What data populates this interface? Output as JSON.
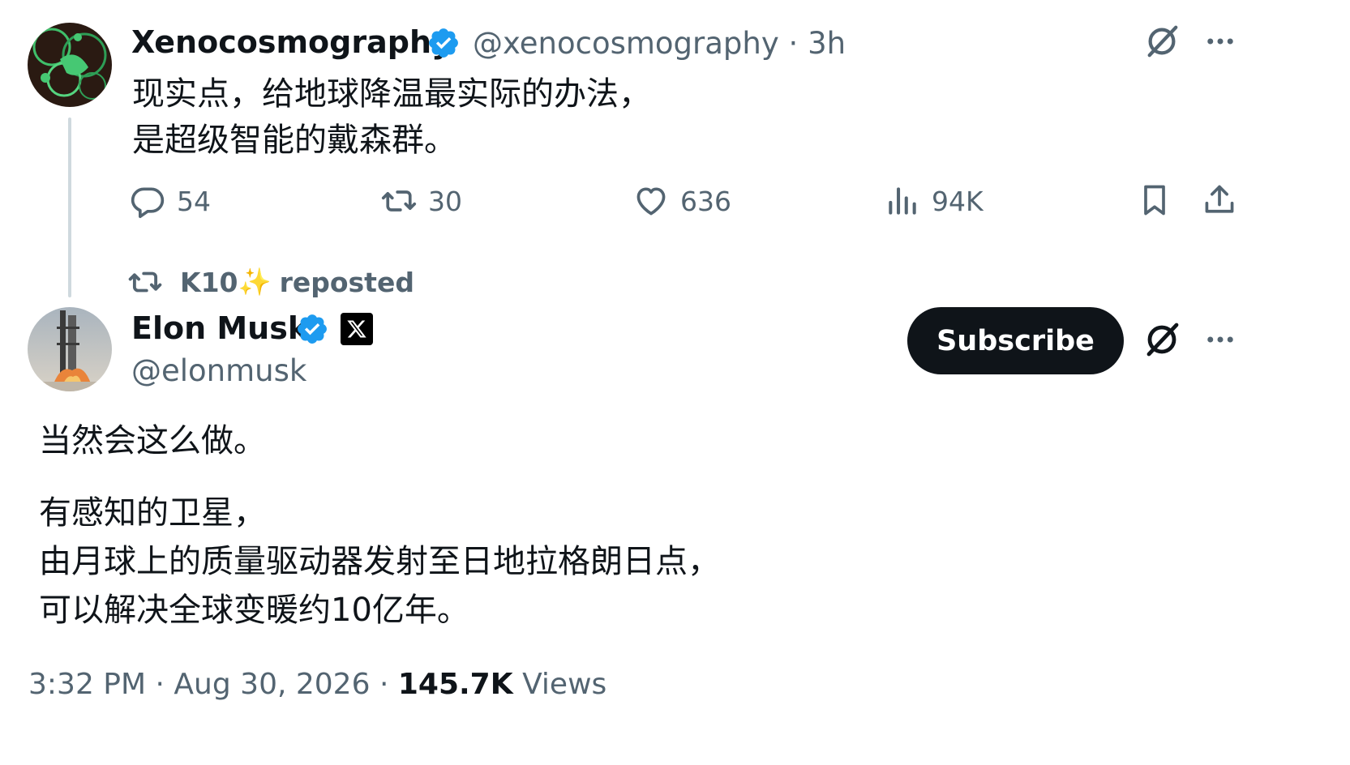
{
  "parent_tweet": {
    "display_name": "Xenocosmography",
    "handle": "@xenocosmography",
    "separator": "·",
    "time": "3h",
    "text_lines": [
      "现实点，给地球降温最实际的办法，",
      "是超级智能的戴森群。"
    ],
    "stats": {
      "replies": "54",
      "reposts": "30",
      "likes": "636",
      "views": "94K"
    }
  },
  "repost_banner": {
    "user": "K10",
    "emoji": "✨",
    "label": "reposted"
  },
  "main_tweet": {
    "display_name": "Elon Musk",
    "handle": "@elonmusk",
    "subscribe_label": "Subscribe",
    "paragraph1": "当然会这么做。",
    "paragraph2_lines": [
      "有感知的卫星，",
      "由月球上的质量驱动器发射至日地拉格朗日点，",
      "可以解决全球变暖约10亿年。"
    ],
    "footer": {
      "time": "3:32 PM",
      "sep1": "·",
      "date": "Aug 30, 2026",
      "sep2": "·",
      "views_count": "145.7K",
      "views_label": "Views"
    }
  },
  "colors": {
    "verified": "#1d9bf0",
    "text": "#0f1419",
    "muted": "#536471",
    "thread_line": "#cfd9de"
  },
  "icons": {
    "grok": "grok-icon",
    "more": "more-icon",
    "reply": "reply-icon",
    "repost": "repost-icon",
    "like": "heart-icon",
    "views": "views-icon",
    "bookmark": "bookmark-icon",
    "share": "share-icon",
    "verified": "verified-badge-icon",
    "x_affiliate": "x-logo-icon"
  }
}
